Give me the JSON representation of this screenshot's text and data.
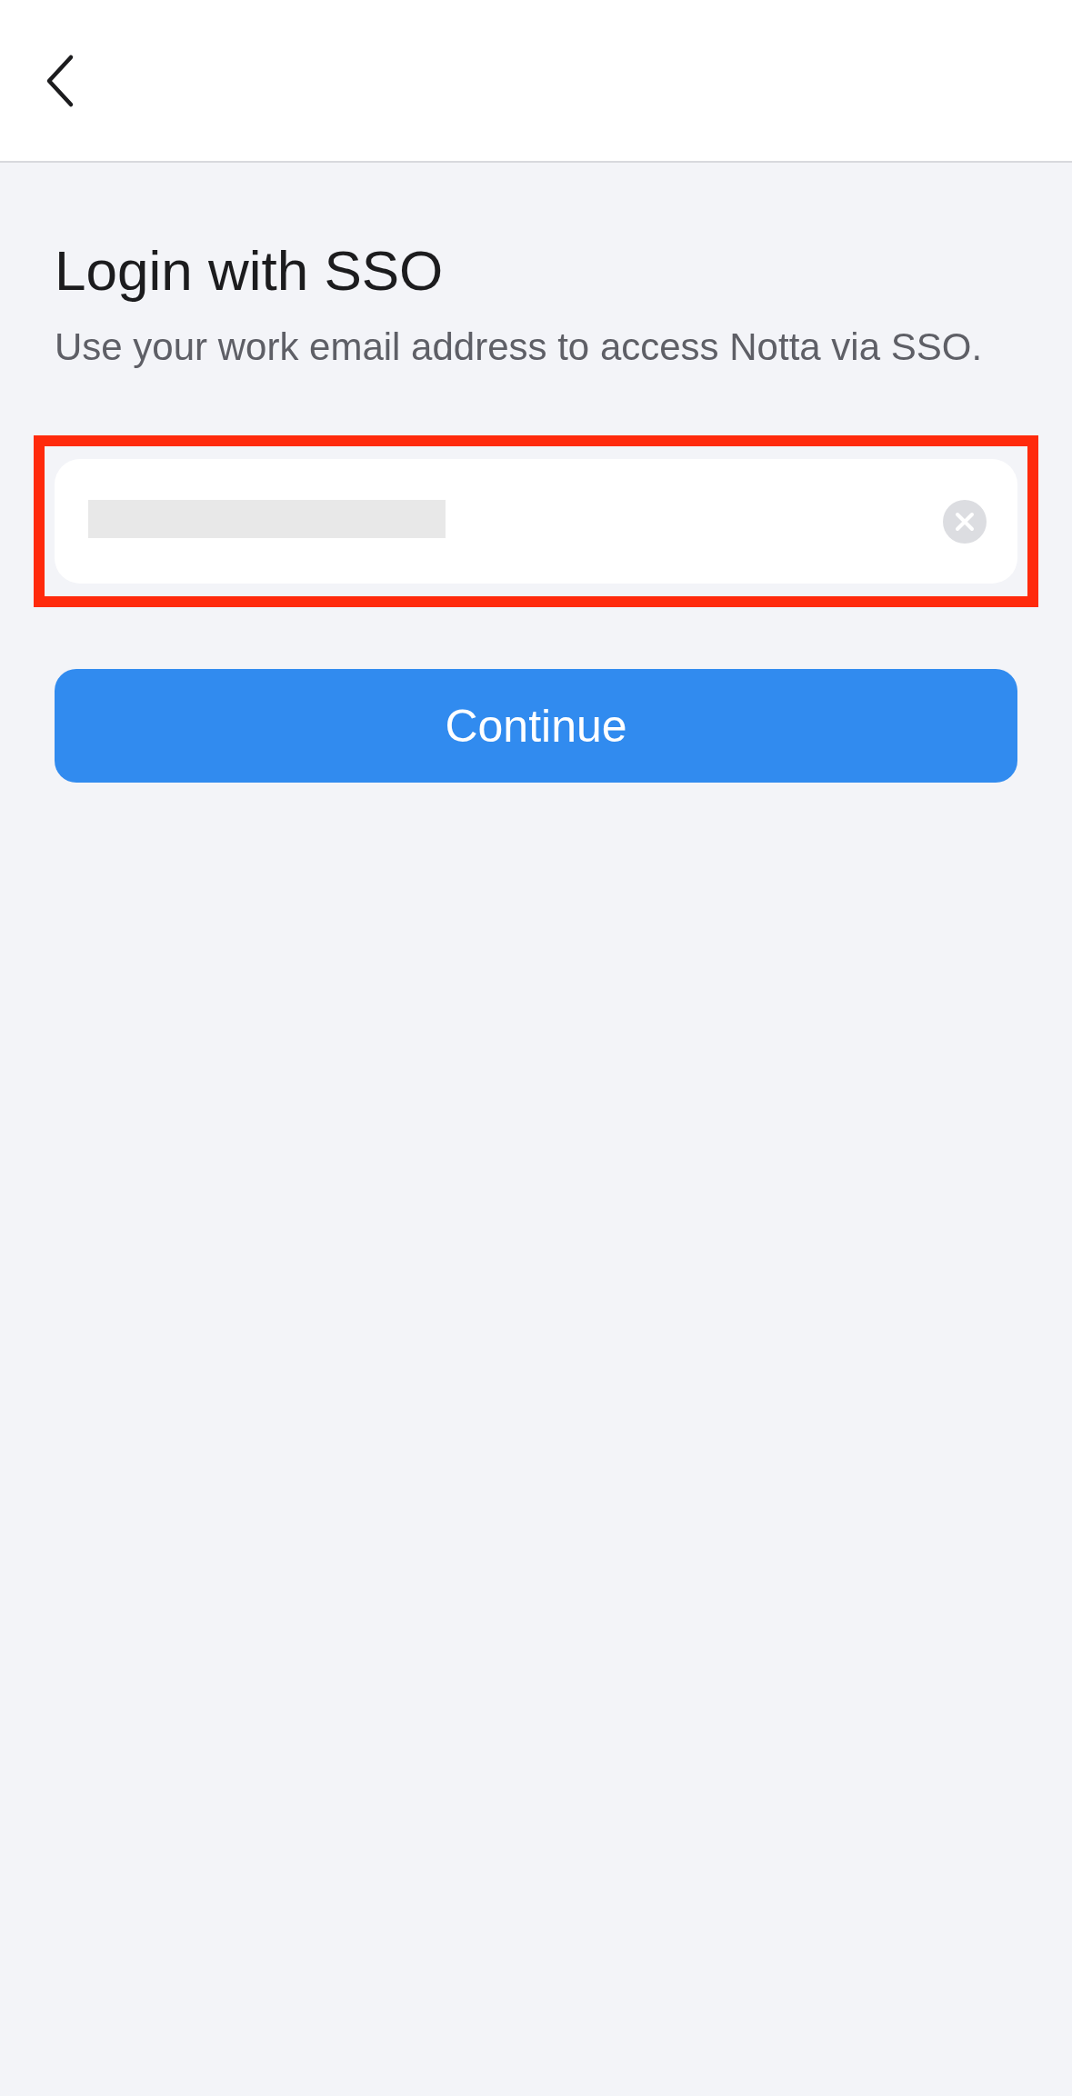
{
  "header": {
    "back": true
  },
  "title": "Login with SSO",
  "subtitle": "Use your work email address to access Notta via SSO.",
  "email_field": {
    "highlighted": true,
    "redacted": true,
    "clearable": true
  },
  "button": "Continue"
}
